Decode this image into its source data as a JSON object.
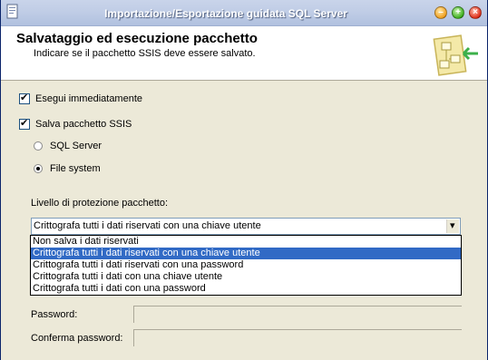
{
  "window": {
    "title": "Importazione/Esportazione guidata SQL Server",
    "controls": {
      "minimize": "–",
      "maximize": "+",
      "close": "×"
    }
  },
  "header": {
    "title": "Salvataggio ed esecuzione pacchetto",
    "subtitle": "Indicare se il pacchetto SSIS deve essere salvato."
  },
  "options": {
    "run_now": {
      "label": "Esegui immediatamente",
      "checked": true
    },
    "save_package": {
      "label": "Salva pacchetto SSIS",
      "checked": true
    },
    "destinations": [
      {
        "label": "SQL Server",
        "selected": false
      },
      {
        "label": "File system",
        "selected": true
      }
    ]
  },
  "protection": {
    "label": "Livello di protezione pacchetto:",
    "selected": "Crittografa tutti i dati riservati con una chiave utente",
    "items": [
      "Non salva i dati riservati",
      "Crittografa tutti i dati riservati con una chiave utente",
      "Crittografa tutti i dati riservati con una password",
      "Crittografa tutti i dati con una chiave utente",
      "Crittografa tutti i dati con una password"
    ]
  },
  "password": {
    "label": "Password:",
    "value": ""
  },
  "confirm_password": {
    "label": "Conferma password:",
    "value": ""
  }
}
